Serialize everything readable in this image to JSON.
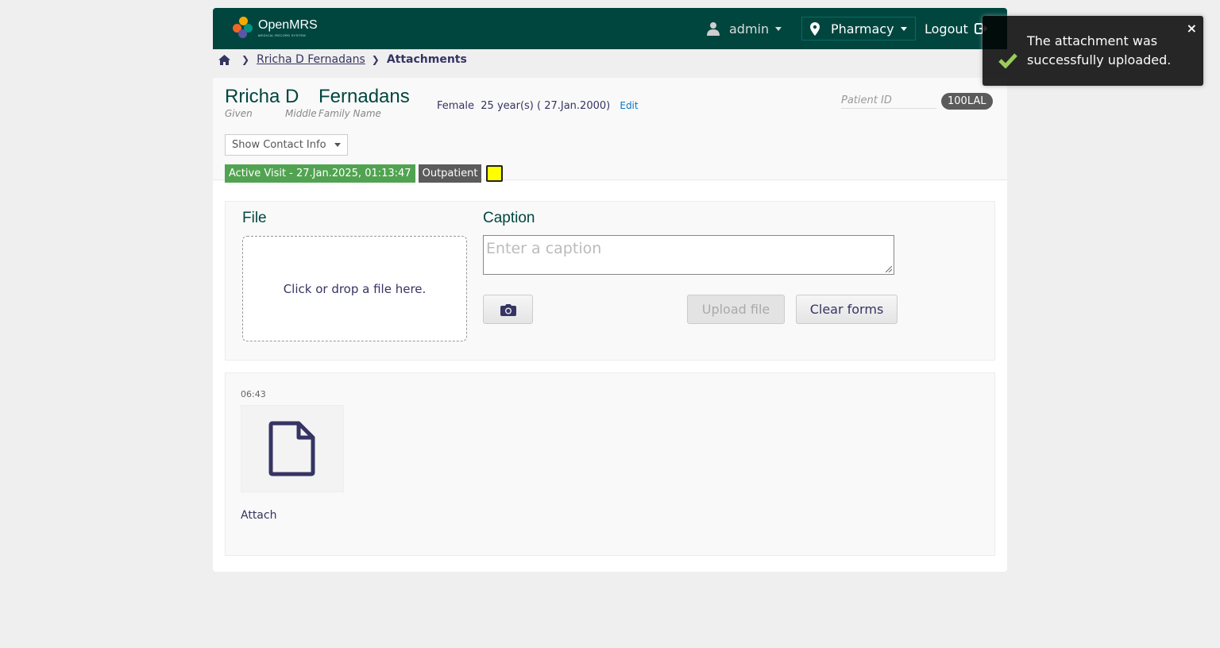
{
  "header": {
    "logo_text": "OpenMRS",
    "logo_subtext": "MEDICAL RECORD SYSTEM",
    "user": "admin",
    "location": "Pharmacy",
    "logout": "Logout"
  },
  "breadcrumb": {
    "patient": "Rricha D Fernadans",
    "current": "Attachments"
  },
  "patient": {
    "given": "Rricha",
    "middle": "D",
    "family": "Fernadans",
    "given_label": "Given",
    "middle_label": "Middle",
    "family_label": "Family Name",
    "gender": "Female",
    "age_dob": "25 year(s) ( 27.Jan.2000)",
    "edit": "Edit",
    "id_label": "Patient ID",
    "id": "100LAL",
    "contact_btn": "Show Contact Info",
    "visit": "Active Visit - 27.Jan.2025, 01:13:47",
    "visit_type": "Outpatient"
  },
  "upload": {
    "file_heading": "File",
    "caption_heading": "Caption",
    "dropzone_text": "Click or drop a file here.",
    "caption_placeholder": "Enter a caption",
    "upload_btn": "Upload file",
    "clear_btn": "Clear forms"
  },
  "attachments": [
    {
      "time": "06:43",
      "caption": "Attach"
    }
  ],
  "toast": {
    "message": "The attachment was successfully uploaded.",
    "close": "×"
  },
  "colors": {
    "header_bg": "#00463f",
    "visit_green": "#51a351",
    "check_green": "#8cc63f"
  }
}
